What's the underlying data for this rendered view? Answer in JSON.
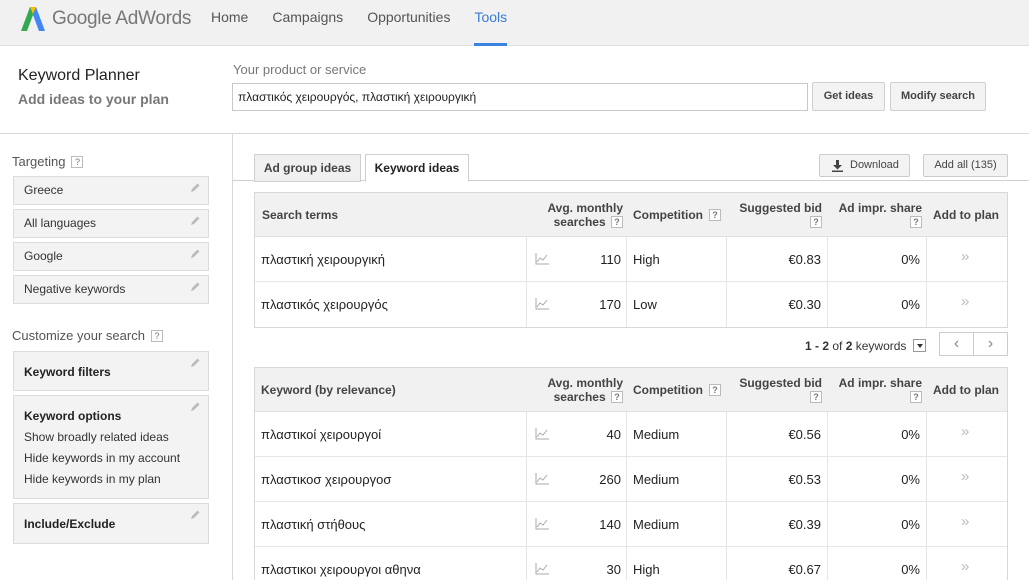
{
  "app": {
    "logo_google": "Google",
    "logo_product": "AdWords"
  },
  "nav": {
    "items": [
      "Home",
      "Campaigns",
      "Opportunities",
      "Tools"
    ],
    "active": "Tools"
  },
  "header": {
    "title": "Keyword Planner",
    "subtitle": "Add ideas to your plan",
    "product_label": "Your product or service",
    "product_value": "πλαστικός χειρουργός, πλαστική χειρουργική",
    "get_ideas": "Get ideas",
    "modify_search": "Modify search"
  },
  "sidebar": {
    "targeting_title": "Targeting",
    "targeting": [
      "Greece",
      "All languages",
      "Google",
      "Negative keywords"
    ],
    "customize_title": "Customize your search",
    "keyword_filters": "Keyword filters",
    "keyword_options": {
      "title": "Keyword options",
      "lines": [
        "Show broadly related ideas",
        "Hide keywords in my account",
        "Hide keywords in my plan"
      ]
    },
    "include_exclude": "Include/Exclude",
    "help_glyph": "?"
  },
  "tabs": {
    "ad_group": "Ad group ideas",
    "keyword": "Keyword ideas",
    "download": "Download",
    "add_all": "Add all (135)"
  },
  "columns": {
    "search_terms": "Search terms",
    "keyword_relevance": "Keyword (by relevance)",
    "avg_monthly_1": "Avg. monthly",
    "avg_monthly_2": "searches",
    "competition": "Competition",
    "suggested_bid": "Suggested bid",
    "ad_impr": "Ad impr. share",
    "add_to_plan": "Add to plan"
  },
  "search_terms_rows": [
    {
      "term": "πλαστική χειρουργική",
      "searches": "110",
      "competition": "High",
      "bid": "€0.83",
      "share": "0%"
    },
    {
      "term": "πλαστικός χειρουργός",
      "searches": "170",
      "competition": "Low",
      "bid": "€0.30",
      "share": "0%"
    }
  ],
  "pager": {
    "range": "1 - 2",
    "of": "of",
    "total": "2",
    "unit": "keywords",
    "prev": "‹",
    "next": "›"
  },
  "keyword_rows": [
    {
      "term": "πλαστικοί χειρουργοί",
      "searches": "40",
      "competition": "Medium",
      "bid": "€0.56",
      "share": "0%"
    },
    {
      "term": "πλαστικοσ χειρουργοσ",
      "searches": "260",
      "competition": "Medium",
      "bid": "€0.53",
      "share": "0%"
    },
    {
      "term": "πλαστική στήθους",
      "searches": "140",
      "competition": "Medium",
      "bid": "€0.39",
      "share": "0%"
    },
    {
      "term": "πλαστικοι χειρουργοι αθηνα",
      "searches": "30",
      "competition": "High",
      "bid": "€0.67",
      "share": "0%"
    }
  ],
  "add_glyph": "»",
  "colors": {
    "accent": "#3b83e0",
    "logo_blue": "#4285f4",
    "logo_green": "#34a853",
    "logo_yellow": "#fbbc05"
  }
}
